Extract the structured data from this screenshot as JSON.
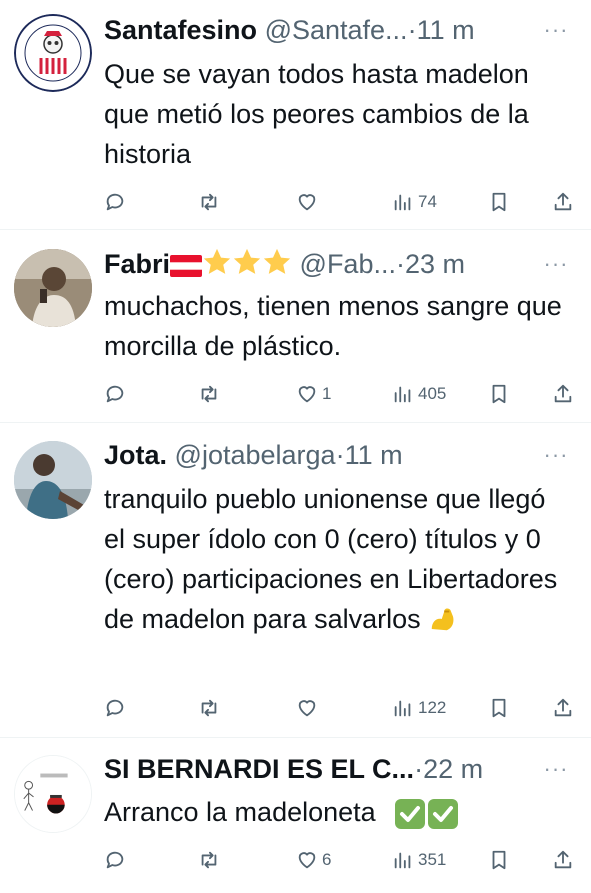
{
  "tweets": [
    {
      "name": "Santafesino",
      "handle": "@Santafe...",
      "dot": "·",
      "time": "11 m",
      "more": "···",
      "text": "Que se vayan todos hasta madelon que metió los peores cambios de la historia",
      "avatar_icon": "team-logo-avatar",
      "replies": "",
      "retweets": "",
      "likes": "",
      "views": "74"
    },
    {
      "name": "Fabri",
      "handle": "@Fab...",
      "dot": "·",
      "time": "23 m",
      "more": "···",
      "text": "muchachos, tienen menos sangre que morcilla de plástico.",
      "avatar_icon": "photo-avatar",
      "name_emojis": [
        "austria-flag-emoji",
        "star-emoji",
        "star-emoji",
        "star-emoji"
      ],
      "replies": "",
      "retweets": "",
      "likes": "1",
      "views": "405"
    },
    {
      "name": "Jota.",
      "handle": "@jotabelarga",
      "dot": "·",
      "time": "11 m",
      "more": "···",
      "text": "tranquilo pueblo unionense que llegó el super ídolo con 0 (cero) títulos y 0 (cero) participaciones en Libertadores de madelon para salvarlos",
      "text_emoji": "flexed-biceps-emoji",
      "avatar_icon": "photo-avatar",
      "replies": "",
      "retweets": "",
      "likes": "",
      "views": "122"
    },
    {
      "name": "SI BERNARDI ES EL C...",
      "handle": "",
      "dot": "·",
      "time": "22 m",
      "more": "···",
      "text": "Arranco la madeloneta",
      "text_emoji": "check-mark-button-emoji",
      "avatar_icon": "drawing-avatar",
      "replies": "",
      "retweets": "",
      "likes": "6",
      "views": "351"
    }
  ],
  "colors": {
    "text": "#0f1419",
    "secondary": "#536471",
    "divider": "#eff3f4",
    "check_green": "#77b255",
    "flex_yellow": "#f4c01e",
    "star_yellow": "#ffcc4d",
    "flag_red": "#e8112d"
  }
}
